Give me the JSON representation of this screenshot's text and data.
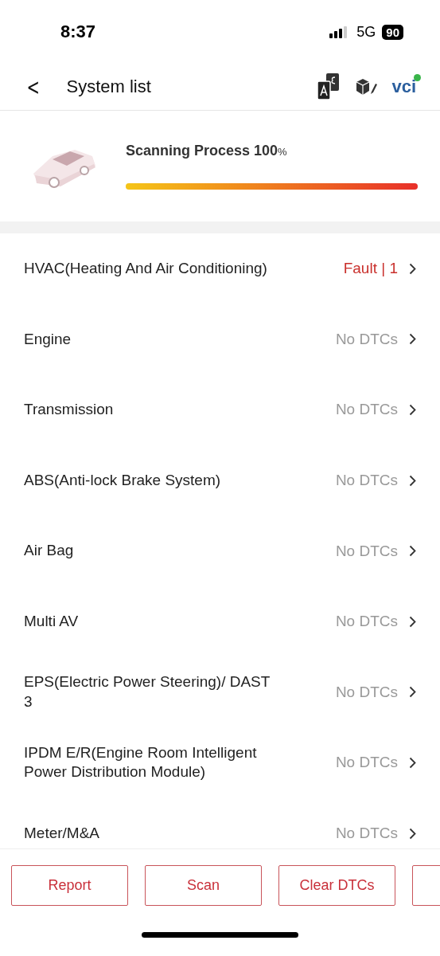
{
  "status_bar": {
    "time": "8:37",
    "network": "5G",
    "battery": "90"
  },
  "header": {
    "back": "<",
    "title": "System list",
    "vci": "vci"
  },
  "scan": {
    "label": "Scanning Process 100",
    "unit": "%",
    "level": 1
  },
  "systems": [
    {
      "name": "HVAC(Heating And Air Conditioning)",
      "status": "Fault | 1",
      "kind": "fault"
    },
    {
      "name": "Engine",
      "status": "No DTCs",
      "kind": "ok"
    },
    {
      "name": "Transmission",
      "status": "No DTCs",
      "kind": "ok"
    },
    {
      "name": "ABS(Anti-lock Brake System)",
      "status": "No DTCs",
      "kind": "ok"
    },
    {
      "name": "Air Bag",
      "status": "No DTCs",
      "kind": "ok"
    },
    {
      "name": "Multi AV",
      "status": "No DTCs",
      "kind": "ok"
    },
    {
      "name": "EPS(Electric Power Steering)/ DAST 3",
      "status": "No DTCs",
      "kind": "ok"
    },
    {
      "name": "IPDM E/R(Engine Room Intelligent Power Distribution Module)",
      "status": "No DTCs",
      "kind": "ok"
    },
    {
      "name": "Meter/M&A",
      "status": "No DTCs",
      "kind": "ok"
    }
  ],
  "buttons": [
    "Report",
    "Scan",
    "Clear DTCs"
  ]
}
